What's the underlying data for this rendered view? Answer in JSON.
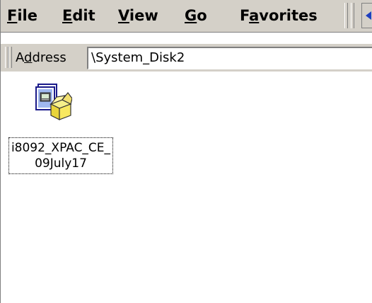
{
  "menubar": {
    "items": [
      {
        "pre": "",
        "u": "F",
        "post": "ile"
      },
      {
        "pre": "",
        "u": "E",
        "post": "dit"
      },
      {
        "pre": "",
        "u": "V",
        "post": "iew"
      },
      {
        "pre": "",
        "u": "G",
        "post": "o"
      },
      {
        "pre": "F",
        "u": "a",
        "post": "vorites"
      }
    ]
  },
  "address": {
    "label_pre": "A",
    "label_u": "d",
    "label_post": "dress",
    "value": "\\System_Disk2"
  },
  "files": [
    {
      "name": "i8092_XPAC_CE_09July17",
      "icon": "installer-package-icon"
    }
  ]
}
